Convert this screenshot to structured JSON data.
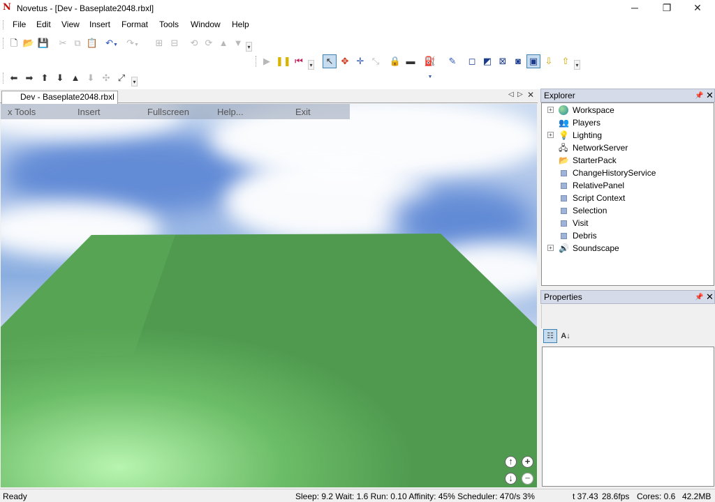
{
  "window": {
    "title": "Novetus - [Dev - Baseplate2048.rbxl]",
    "minimize_glyph": "─",
    "maximize_glyph": "❐",
    "close_glyph": "✕"
  },
  "menu": [
    "File",
    "Edit",
    "View",
    "Insert",
    "Format",
    "Tools",
    "Window",
    "Help"
  ],
  "document_tab": {
    "label": "Dev - Baseplate2048.rbxl",
    "close_glyph": "✕"
  },
  "game_menu": [
    "x Tools",
    "Insert",
    "Fullscreen",
    "Help...",
    "Exit"
  ],
  "explorer": {
    "title": "Explorer",
    "items": [
      {
        "label": "Workspace",
        "icon": "globe-icon",
        "expandable": true
      },
      {
        "label": "Players",
        "icon": "players-icon",
        "expandable": false
      },
      {
        "label": "Lighting",
        "icon": "lightbulb-icon",
        "expandable": true
      },
      {
        "label": "NetworkServer",
        "icon": "network-icon",
        "expandable": false
      },
      {
        "label": "StarterPack",
        "icon": "folder-icon",
        "expandable": false
      },
      {
        "label": "ChangeHistoryService",
        "icon": "service-icon",
        "expandable": false
      },
      {
        "label": "RelativePanel",
        "icon": "service-icon",
        "expandable": false
      },
      {
        "label": "Script Context",
        "icon": "service-icon",
        "expandable": false
      },
      {
        "label": "Selection",
        "icon": "service-icon",
        "expandable": false
      },
      {
        "label": "Visit",
        "icon": "service-icon",
        "expandable": false
      },
      {
        "label": "Debris",
        "icon": "service-icon",
        "expandable": false
      },
      {
        "label": "Soundscape",
        "icon": "speaker-icon",
        "expandable": true
      }
    ]
  },
  "properties": {
    "title": "Properties"
  },
  "status": {
    "ready": "Ready",
    "perf": "Sleep: 9.2 Wait: 1.6 Run: 0.10 Affinity: 45% Scheduler: 470/s 3%",
    "time": "t 37.43",
    "fps": "28.6fps",
    "cores": "Cores: 0.6",
    "memory": "42.2MB"
  },
  "colors": {
    "accent": "#3c7fb1",
    "ground": "#4f9a4f",
    "sky": "#8aaee0"
  }
}
